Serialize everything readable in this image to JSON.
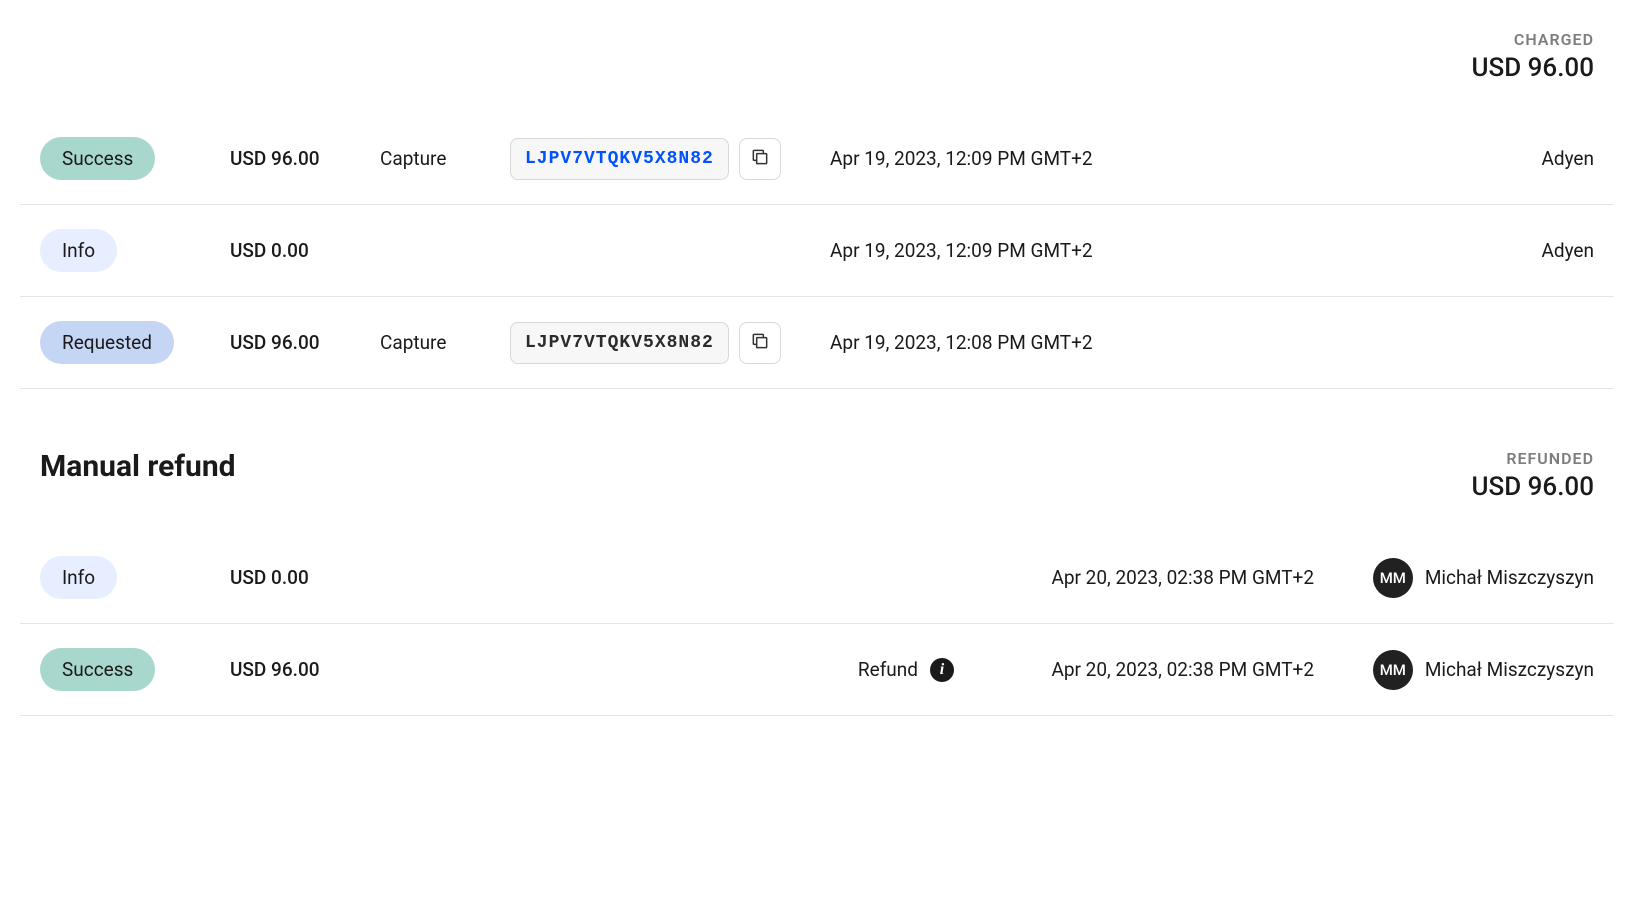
{
  "charged": {
    "label": "CHARGED",
    "amount": "USD 96.00"
  },
  "transactions": [
    {
      "status": "Success",
      "statusClass": "badge-success",
      "amount": "USD 96.00",
      "type": "Capture",
      "code": "LJPV7VTQKV5X8N82",
      "codeStyle": "code-blue",
      "hasCopy": true,
      "date": "Apr 19, 2023, 12:09 PM GMT+2",
      "provider": "Adyen"
    },
    {
      "status": "Info",
      "statusClass": "badge-info",
      "amount": "USD 0.00",
      "type": "",
      "code": "",
      "codeStyle": "",
      "hasCopy": false,
      "date": "Apr 19, 2023, 12:09 PM GMT+2",
      "provider": "Adyen"
    },
    {
      "status": "Requested",
      "statusClass": "badge-requested",
      "amount": "USD 96.00",
      "type": "Capture",
      "code": "LJPV7VTQKV5X8N82",
      "codeStyle": "code-dark",
      "hasCopy": true,
      "date": "Apr 19, 2023, 12:08 PM GMT+2",
      "provider": ""
    }
  ],
  "refundSection": {
    "title": "Manual refund",
    "summaryLabel": "REFUNDED",
    "summaryAmount": "USD 96.00"
  },
  "refunds": [
    {
      "status": "Info",
      "statusClass": "badge-info",
      "amount": "USD 0.00",
      "type": "",
      "hasInfoIcon": false,
      "date": "Apr 20, 2023, 02:38 PM GMT+2",
      "userInitials": "MM",
      "userName": "Michał Miszczyszyn"
    },
    {
      "status": "Success",
      "statusClass": "badge-success",
      "amount": "USD 96.00",
      "type": "Refund",
      "hasInfoIcon": true,
      "date": "Apr 20, 2023, 02:38 PM GMT+2",
      "userInitials": "MM",
      "userName": "Michał Miszczyszyn"
    }
  ]
}
